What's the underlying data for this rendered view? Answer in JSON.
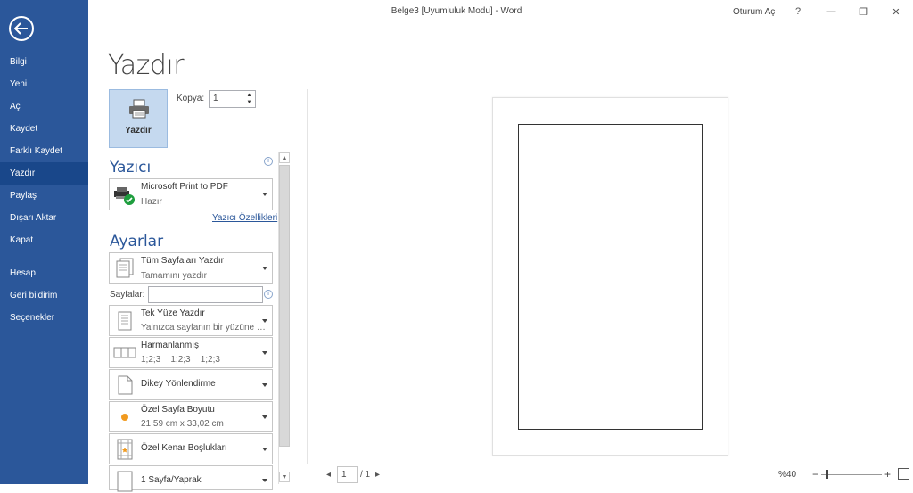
{
  "titlebar": {
    "title": "Belge3 [Uyumluluk Modu]  -  Word",
    "signin": "Oturum Aç",
    "help": "?",
    "minimize": "—",
    "restore": "❐",
    "close": "✕"
  },
  "sidebar": {
    "back_icon": "arrow-left-icon",
    "items": [
      {
        "label": "Bilgi"
      },
      {
        "label": "Yeni"
      },
      {
        "label": "Aç"
      },
      {
        "label": "Kaydet"
      },
      {
        "label": "Farklı Kaydet"
      },
      {
        "label": "Yazdır",
        "active": true
      },
      {
        "label": "Paylaş"
      },
      {
        "label": "Dışarı Aktar"
      },
      {
        "label": "Kapat"
      },
      {
        "label": "Hesap"
      },
      {
        "label": "Geri bildirim"
      },
      {
        "label": "Seçenekler"
      }
    ]
  },
  "main": {
    "title": "Yazdır",
    "print_button": "Yazdır",
    "copies_label": "Kopya:",
    "copies_value": "1",
    "printer_heading": "Yazıcı",
    "printer": {
      "name": "Microsoft Print to PDF",
      "status": "Hazır"
    },
    "printer_properties": "Yazıcı Özellikleri",
    "settings_heading": "Ayarlar",
    "settings": [
      {
        "line1": "Tüm Sayfaları Yazdır",
        "line2": "Tamamını yazdır"
      },
      {
        "line1": "Tek Yüze Yazdır",
        "line2": "Yalnızca sayfanın bir yüzüne y..."
      },
      {
        "line1": "Harmanlanmış",
        "line2": "1;2;3    1;2;3    1;2;3"
      },
      {
        "line1": "Dikey Yönlendirme",
        "line2": ""
      },
      {
        "line1": "Özel Sayfa Boyutu",
        "line2": "21,59 cm x 33,02 cm"
      },
      {
        "line1": "Özel Kenar Boşlukları",
        "line2": ""
      },
      {
        "line1": "1 Sayfa/Yaprak",
        "line2": ""
      }
    ],
    "pages_label": "Sayfalar:",
    "pages_value": ""
  },
  "preview": {
    "current_page": "1",
    "total_pages": "/ 1",
    "zoom": "%40"
  }
}
